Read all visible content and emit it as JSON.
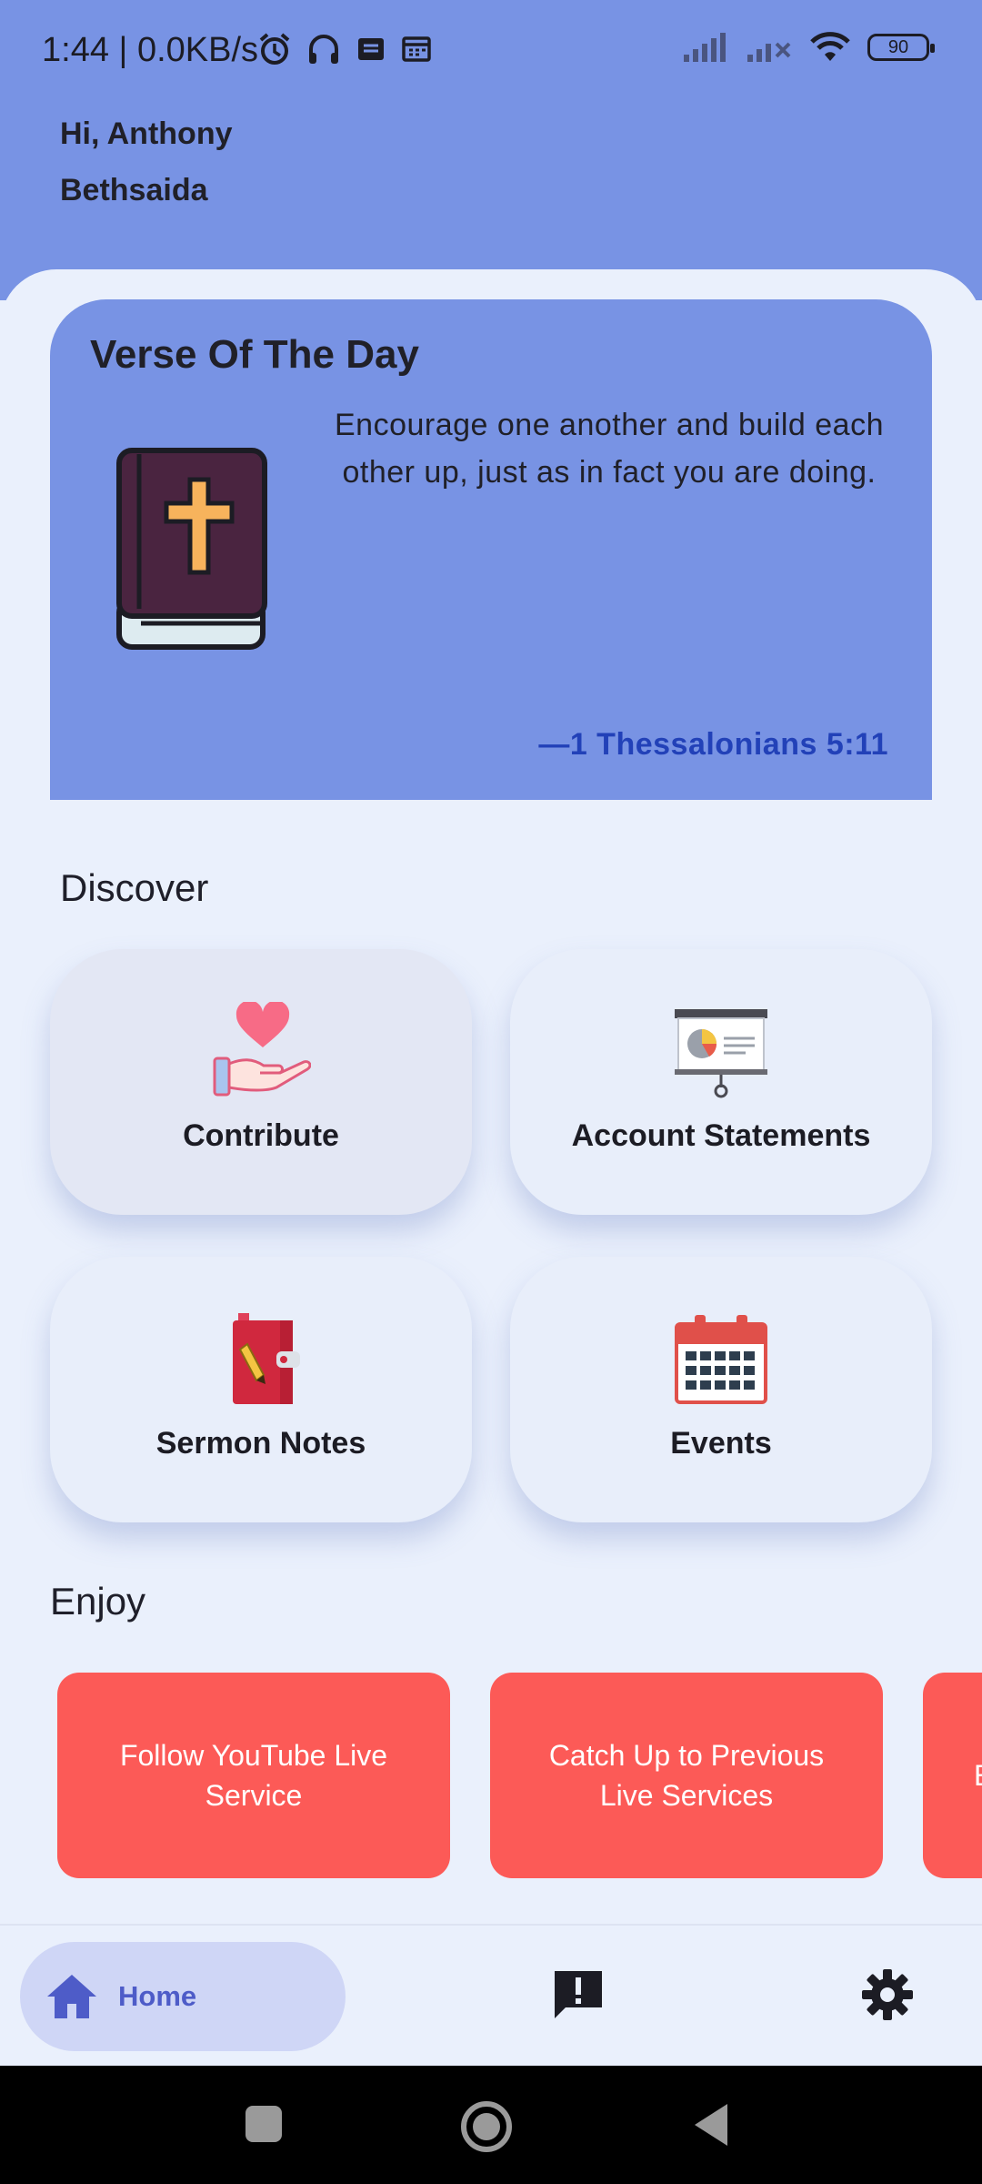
{
  "status_bar": {
    "time_speed": "1:44 | 0.0KB/s",
    "battery": "90"
  },
  "greeting": {
    "line1": "Hi,  Anthony",
    "line2": "Bethsaida"
  },
  "verse": {
    "title": "Verse Of The Day",
    "text": "Encourage one another and build each other up, just as in fact you are doing.",
    "reference": "—1 Thessalonians 5:11"
  },
  "discover": {
    "label": "Discover",
    "tiles": [
      {
        "label": "Contribute",
        "icon": "heart-hand-icon"
      },
      {
        "label": "Account Statements",
        "icon": "presentation-chart-icon"
      },
      {
        "label": "Sermon Notes",
        "icon": "notebook-pen-icon"
      },
      {
        "label": "Events",
        "icon": "calendar-icon"
      }
    ]
  },
  "enjoy": {
    "label": "Enjoy",
    "cards": [
      {
        "label": "Follow YouTube Live Service"
      },
      {
        "label": "Catch Up to Previous Live Services"
      },
      {
        "label": "E"
      }
    ]
  },
  "nav": {
    "home_label": "Home",
    "items": [
      "home-icon",
      "feedback-icon",
      "settings-icon"
    ]
  },
  "colors": {
    "header": "#7893E4",
    "background": "#EAF0FC",
    "enjoy_card": "#FC5A57",
    "verse_reference": "#2241B8",
    "nav_active": "#CFD6F6"
  }
}
